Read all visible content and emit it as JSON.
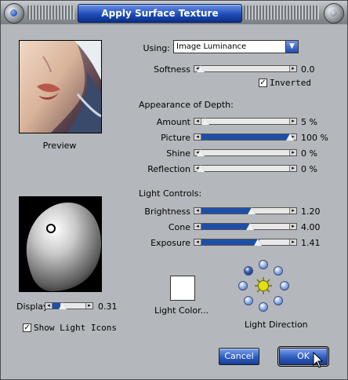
{
  "dialog": {
    "title": "Apply Surface Texture"
  },
  "preview": {
    "label": "Preview"
  },
  "using": {
    "label": "Using:",
    "value": "Image Luminance"
  },
  "softness": {
    "label": "Softness",
    "value": "0.0",
    "fraction": 0.0
  },
  "inverted": {
    "label": "Inverted",
    "checked": true
  },
  "depth": {
    "heading": "Appearance of Depth:",
    "sliders": [
      {
        "label": "Amount",
        "value": "5 %",
        "fraction": 0.05
      },
      {
        "label": "Picture",
        "value": "100 %",
        "fraction": 1.0
      },
      {
        "label": "Shine",
        "value": "0 %",
        "fraction": 0.0
      },
      {
        "label": "Reflection",
        "value": "0 %",
        "fraction": 0.0
      }
    ]
  },
  "light": {
    "heading": "Light Controls:",
    "sliders": [
      {
        "label": "Brightness",
        "value": "1.20",
        "fraction": 0.57
      },
      {
        "label": "Cone",
        "value": "4.00",
        "fraction": 0.55
      },
      {
        "label": "Exposure",
        "value": "1.41",
        "fraction": 0.64
      }
    ],
    "color_label": "Light Color...",
    "direction_label": "Light Direction"
  },
  "display": {
    "label": "Display",
    "value": "0.31",
    "fraction": 0.31
  },
  "show_light_icons": {
    "label": "Show Light Icons",
    "checked": true
  },
  "buttons": {
    "cancel": "Cancel",
    "ok": "OK"
  },
  "colors": {
    "accent": "#1e4fa8",
    "title_bar": "#1e4db9",
    "dialog_bg": "#b4b8bc"
  }
}
